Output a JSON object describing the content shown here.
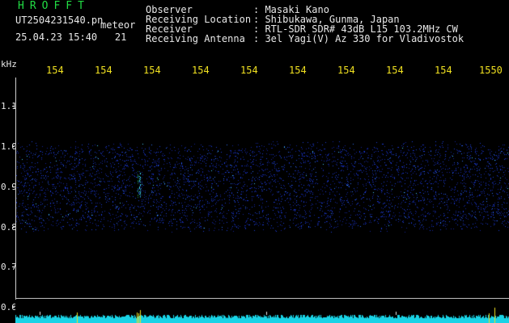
{
  "header": {
    "app_title": "HROFFT",
    "filename": "UT2504231540.pn",
    "mode": "meteor",
    "datetime": "25.04.23 15:40",
    "count": "21",
    "fields": [
      {
        "label": "Observer",
        "value": ": Masaki Kano"
      },
      {
        "label": "Receiving Location",
        "value": ": Shibukawa, Gunma, Japan"
      },
      {
        "label": "Receiver",
        "value": ": RTL-SDR SDR# 43dB L15 103.2MHz CW"
      },
      {
        "label": "Receiving Antenna",
        "value": ": 3el Yagi(V) Az 330 for Vladivostok"
      }
    ]
  },
  "x_axis": {
    "ticks": [
      "154",
      "154",
      "154",
      "154",
      "154",
      "154",
      "154",
      "154",
      "154",
      "1550"
    ]
  },
  "y_axis": {
    "unit": "kHz",
    "ticks": [
      "1.1",
      "1.0",
      "0.9",
      "0.8",
      "0.7",
      "0.6"
    ]
  },
  "colors": {
    "noise": "#1d3cd8",
    "signal": "#3fe0ff",
    "meter": "#19d3e6",
    "spike": "#f0e020"
  }
}
